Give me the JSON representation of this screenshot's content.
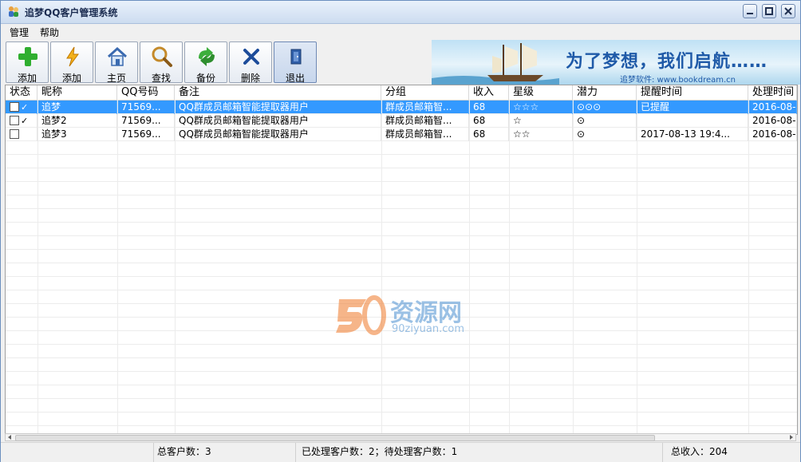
{
  "window": {
    "title": "追梦QQ客户管理系统"
  },
  "menu": {
    "items": [
      "管理",
      "帮助"
    ]
  },
  "toolbar": {
    "buttons": [
      {
        "label": "添加",
        "icon": "plus-icon"
      },
      {
        "label": "添加",
        "icon": "lightning-icon"
      },
      {
        "label": "主页",
        "icon": "home-icon"
      },
      {
        "label": "查找",
        "icon": "search-icon"
      },
      {
        "label": "备份",
        "icon": "backup-icon"
      },
      {
        "label": "删除",
        "icon": "delete-x-icon"
      },
      {
        "label": "退出",
        "icon": "exit-door-icon"
      }
    ]
  },
  "banner": {
    "slogan": "为了梦想，我们启航……",
    "subtitle": "追梦软件: www.bookdream.cn"
  },
  "table": {
    "columns": [
      "状态",
      "昵称",
      "QQ号码",
      "备注",
      "分组",
      "收入",
      "星级",
      "潜力",
      "提醒时间",
      "处理时间"
    ],
    "rows": [
      {
        "checked_mark": "✓",
        "nickname": "追梦",
        "qq": "71569...",
        "note": "QQ群成员邮箱智能提取器用户",
        "group": "群成员邮箱智...",
        "income": "68",
        "stars": "☆☆☆",
        "potential": "⊙⊙⊙",
        "remind": "已提醒",
        "handled": "2016-08-"
      },
      {
        "checked_mark": "✓",
        "nickname": "追梦2",
        "qq": "71569...",
        "note": "QQ群成员邮箱智能提取器用户",
        "group": "群成员邮箱智...",
        "income": "68",
        "stars": "☆",
        "potential": "⊙",
        "remind": "",
        "handled": "2016-08-"
      },
      {
        "checked_mark": "",
        "nickname": "追梦3",
        "qq": "71569...",
        "note": "QQ群成员邮箱智能提取器用户",
        "group": "群成员邮箱智...",
        "income": "68",
        "stars": "☆☆",
        "potential": "⊙",
        "remind": "2017-08-13 19:4...",
        "handled": "2016-08-"
      }
    ]
  },
  "watermark": {
    "text": "资源网",
    "sub": "90ziyuan.com"
  },
  "status": {
    "total": "总客户数：3",
    "processed": "已处理客户数：2；待处理客户数：1",
    "income": "总收入：204"
  },
  "colors": {
    "selection": "#3399ff",
    "titlebar": "#cddcf0",
    "banner_text": "#1f5aa8"
  }
}
